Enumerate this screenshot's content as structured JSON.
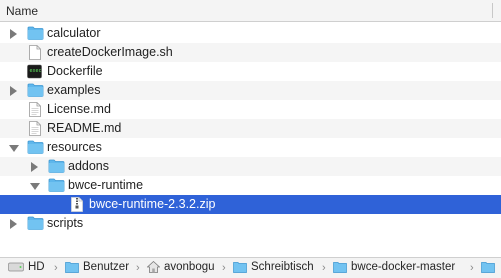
{
  "header": {
    "column_name": "Name"
  },
  "rows": [
    {
      "name": "calculator",
      "kind": "folder",
      "disclosure": "collapsed"
    },
    {
      "name": "createDockerImage.sh",
      "kind": "script"
    },
    {
      "name": "Dockerfile",
      "kind": "exec"
    },
    {
      "name": "examples",
      "kind": "folder",
      "disclosure": "collapsed"
    },
    {
      "name": "License.md",
      "kind": "doc"
    },
    {
      "name": "README.md",
      "kind": "doc"
    },
    {
      "name": "resources",
      "kind": "folder",
      "disclosure": "expanded"
    },
    {
      "name": "addons",
      "kind": "folder",
      "disclosure": "collapsed"
    },
    {
      "name": "bwce-runtime",
      "kind": "folder",
      "disclosure": "expanded"
    },
    {
      "name": "bwce-runtime-2.3.2.zip",
      "kind": "zip",
      "selected": true
    },
    {
      "name": "scripts",
      "kind": "folder",
      "disclosure": "collapsed"
    }
  ],
  "path_bar": {
    "items": [
      {
        "label": "HD",
        "icon": "drive-icon"
      },
      {
        "label": "Benutzer",
        "icon": "folder-icon"
      },
      {
        "label": "avonbogu",
        "icon": "home-icon"
      },
      {
        "label": "Schreibtisch",
        "icon": "folder-icon"
      },
      {
        "label": "bwce-docker-master",
        "icon": "folder-icon"
      }
    ]
  },
  "colors": {
    "selection": "#2f62d8",
    "folder": "#5fb7ec"
  }
}
